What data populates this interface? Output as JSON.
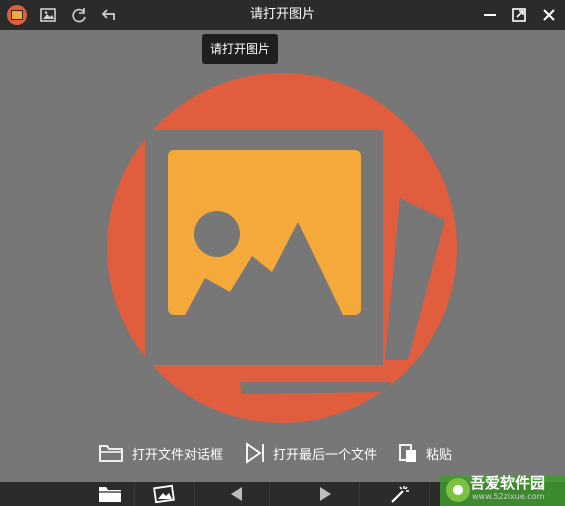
{
  "window": {
    "title": "请打开图片"
  },
  "tooltip": {
    "text": "请打开图片"
  },
  "actions": {
    "open_dialog": "打开文件对话框",
    "open_last": "打开最后一个文件",
    "paste": "粘贴"
  },
  "watermark": {
    "name": "吾爱软件园",
    "url": "www.52zixue.com"
  },
  "colors": {
    "accent_orange": "#e05d3d",
    "photo_yellow": "#f5a93a",
    "bar_dark": "#2b2b2b",
    "background": "#777777"
  },
  "icons": {
    "app": "app-logo-icon",
    "gallery": "gallery-icon",
    "rotate": "rotate-icon",
    "undo": "undo-icon",
    "minimize": "minimize-icon",
    "restore": "restore-icon",
    "close": "close-icon",
    "folder": "folder-icon",
    "play": "play-icon",
    "paste": "paste-icon",
    "images": "images-icon",
    "prev": "prev-arrow-icon",
    "next": "next-arrow-icon",
    "magic": "magic-wand-icon"
  }
}
